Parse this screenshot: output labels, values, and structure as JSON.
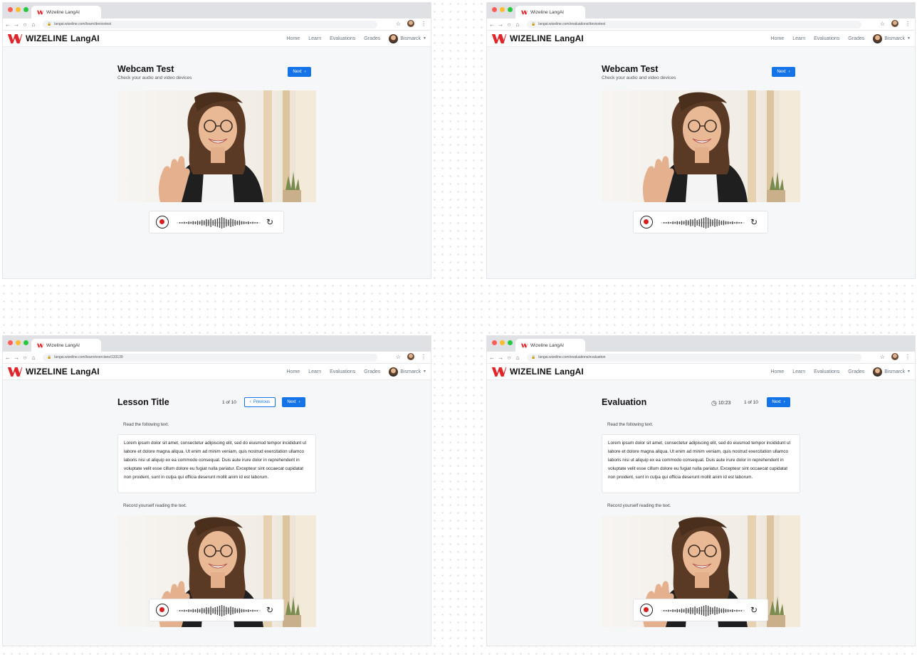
{
  "browser": {
    "tab_title": "Wizeline LangAI",
    "urls": {
      "f1": "langai.wizeline.com/learn/devicetest",
      "f2": "langai.wizeline.com/evaluations/devicetest",
      "f3": "langai.wizeline.com/learn/exercises/133139",
      "f4": "langai.wizeline.com/evaluations/evaluation"
    }
  },
  "header": {
    "brand": "WIZELINE",
    "brand_suffix": "LangAI",
    "nav": [
      "Home",
      "Learn",
      "Evaluations",
      "Grades"
    ],
    "user_name": "Bismarck"
  },
  "webcam": {
    "title": "Webcam Test",
    "subtitle": "Check your audio and video devices",
    "next_label": "Next"
  },
  "lesson": {
    "title": "Lesson Title",
    "counter": "1 of 10",
    "previous_label": "Previous",
    "next_label": "Next",
    "instruction": "Read the following text.",
    "passage": "Lorem ipsum dolor sit amet, consectetur adipiscing elit, sed do eiusmod tempor incididunt ut labore et dolore magna aliqua. Ut enim ad minim veniam, quis nostrud exercitation ullamco laboris nisi ut aliquip ex ea commodo consequat. Duis aute irure dolor in reprehenderit in voluptate velit esse cillum dolore eu fugiat nulla pariatur. Excepteur sint occaecat cupidatat non proident, sunt in culpa qui officia deserunt mollit anim id est laborum.",
    "record_instruction": "Record yourself reading the text."
  },
  "evaluation": {
    "title": "Evaluation",
    "timer": "10:23",
    "counter": "1 of 10",
    "next_label": "Next",
    "instruction": "Read the following text.",
    "passage": "Lorem ipsum dolor sit amet, consectetur adipiscing elit, sed do eiusmod tempor incididunt ut labore et dolore magna aliqua. Ut enim ad minim veniam, quis nostrud exercitation ullamco laboris nisi ut aliquip ex ea commodo consequat. Duis aute irure dolor in reprehenderit in voluptate velit esse cillum dolore eu fugiat nulla pariatur. Excepteur sint occaecat cupidatat non proident, sunt in culpa qui officia deserunt mollit anim id est laborum.",
    "record_instruction": "Record yourself reading the text."
  },
  "icons": {
    "record": "record-icon",
    "waveform": "audio-waveform-icon",
    "reset": "reset-icon",
    "timer": "clock-icon"
  },
  "colors": {
    "primary": "#1473e6",
    "record_red": "#d3201f",
    "brand_red": "#e0252b",
    "page_bg": "#f6f7f9"
  }
}
